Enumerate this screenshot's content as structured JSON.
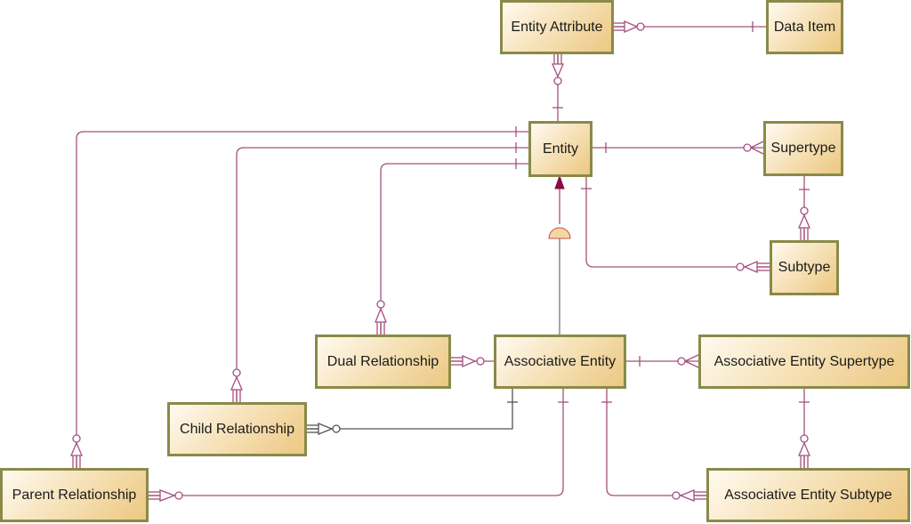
{
  "diagram": {
    "type": "entity-relationship",
    "line_color": "#a3507e",
    "association_line_color": "#555555",
    "entities": [
      {
        "id": "entity_attribute",
        "label": "Entity Attribute"
      },
      {
        "id": "data_item",
        "label": "Data Item"
      },
      {
        "id": "entity",
        "label": "Entity"
      },
      {
        "id": "supertype",
        "label": "Supertype"
      },
      {
        "id": "subtype",
        "label": "Subtype"
      },
      {
        "id": "dual_relationship",
        "label": "Dual Relationship"
      },
      {
        "id": "associative_entity",
        "label": "Associative Entity"
      },
      {
        "id": "associative_entity_supertype",
        "label": "Associative Entity Supertype"
      },
      {
        "id": "child_relationship",
        "label": "Child Relationship"
      },
      {
        "id": "parent_relationship",
        "label": "Parent Relationship"
      },
      {
        "id": "associative_entity_subtype",
        "label": "Associative Entity Subtype"
      }
    ],
    "relationships": [
      {
        "from": "data_item",
        "to": "entity_attribute",
        "cardinality": "one-to-zero-or-many-identifying"
      },
      {
        "from": "entity",
        "to": "entity_attribute",
        "cardinality": "one-to-zero-or-many-identifying"
      },
      {
        "from": "entity",
        "to": "supertype",
        "cardinality": "one-to-zero-or-many"
      },
      {
        "from": "entity",
        "to": "subtype",
        "cardinality": "one-to-zero-or-many-identifying"
      },
      {
        "from": "supertype",
        "to": "subtype",
        "cardinality": "one-to-zero-or-many-identifying"
      },
      {
        "from": "entity",
        "to": "dual_relationship",
        "cardinality": "one-to-zero-or-many-identifying"
      },
      {
        "from": "entity",
        "to": "child_relationship",
        "cardinality": "one-to-zero-or-many-identifying"
      },
      {
        "from": "entity",
        "to": "parent_relationship",
        "cardinality": "one-to-zero-or-many-identifying"
      },
      {
        "from": "associative_entity",
        "to": "entity",
        "cardinality": "subtype-inheritance"
      },
      {
        "from": "associative_entity",
        "to": "dual_relationship",
        "cardinality": "one-to-zero-or-many-identifying"
      },
      {
        "from": "associative_entity",
        "to": "child_relationship",
        "cardinality": "one-to-zero-or-many-identifying"
      },
      {
        "from": "associative_entity",
        "to": "parent_relationship",
        "cardinality": "one-to-zero-or-many-identifying"
      },
      {
        "from": "associative_entity",
        "to": "associative_entity_supertype",
        "cardinality": "one-to-zero-or-many"
      },
      {
        "from": "associative_entity",
        "to": "associative_entity_subtype",
        "cardinality": "one-to-zero-or-many-identifying"
      },
      {
        "from": "associative_entity_supertype",
        "to": "associative_entity_subtype",
        "cardinality": "one-to-zero-or-many-identifying"
      }
    ]
  }
}
